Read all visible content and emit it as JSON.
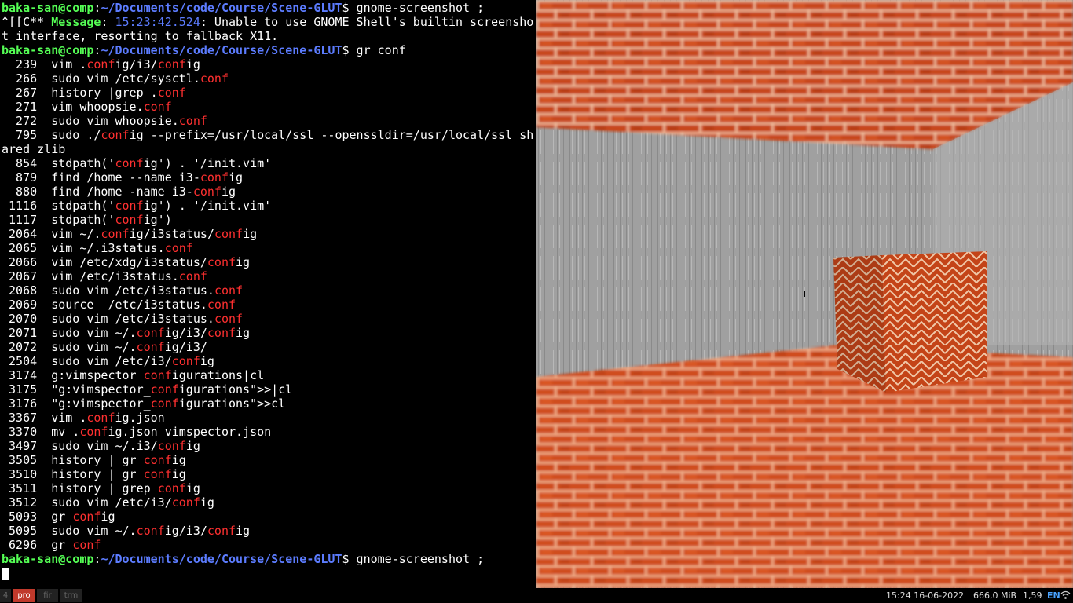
{
  "terminal": {
    "prompt_user": "baka-san@comp",
    "prompt_path": "~/Documents/code/Course/Scene-GLUT",
    "cmd1": "gnome-screenshot ;",
    "msg_prefix": "^[[C** ",
    "msg_label": "Message",
    "msg_colon": ": ",
    "msg_time": "15:23:42.524",
    "msg_text": ": Unable to use GNOME Shell's builtin screensho",
    "msg_wrap": "t interface, resorting to fallback X11.",
    "cmd2": "gr conf",
    "cmd3": "gnome-screenshot ;",
    "history": [
      {
        "num": "  239",
        "cmd": [
          "vim .",
          {
            "h": "conf"
          },
          "ig/i3/",
          {
            "h": "conf"
          },
          "ig"
        ]
      },
      {
        "num": "  266",
        "cmd": [
          "sudo vim /etc/sysctl.",
          {
            "h": "conf"
          }
        ]
      },
      {
        "num": "  267",
        "cmd": [
          "history |grep .",
          {
            "h": "conf"
          }
        ]
      },
      {
        "num": "  271",
        "cmd": [
          "vim whoopsie.",
          {
            "h": "conf"
          }
        ]
      },
      {
        "num": "  272",
        "cmd": [
          "sudo vim whoopsie.",
          {
            "h": "conf"
          }
        ]
      },
      {
        "num": "  795",
        "cmd": [
          "sudo ./",
          {
            "h": "conf"
          },
          "ig --prefix=/usr/local/ssl --openssldir=/usr/local/ssl sh"
        ]
      },
      {
        "num": "",
        "cmd": [
          "ared zlib"
        ]
      },
      {
        "num": "  854",
        "cmd": [
          "stdpath('",
          {
            "h": "conf"
          },
          "ig') . '/init.vim'"
        ]
      },
      {
        "num": "  879",
        "cmd": [
          "find /home --name i3-",
          {
            "h": "conf"
          },
          "ig"
        ]
      },
      {
        "num": "  880",
        "cmd": [
          "find /home -name i3-",
          {
            "h": "conf"
          },
          "ig"
        ]
      },
      {
        "num": " 1116",
        "cmd": [
          "stdpath('",
          {
            "h": "conf"
          },
          "ig') . '/init.vim'"
        ]
      },
      {
        "num": " 1117",
        "cmd": [
          "stdpath('",
          {
            "h": "conf"
          },
          "ig')"
        ]
      },
      {
        "num": " 2064",
        "cmd": [
          "vim ~/.",
          {
            "h": "conf"
          },
          "ig/i3status/",
          {
            "h": "conf"
          },
          "ig"
        ]
      },
      {
        "num": " 2065",
        "cmd": [
          "vim ~/.i3status.",
          {
            "h": "conf"
          }
        ]
      },
      {
        "num": " 2066",
        "cmd": [
          "vim /etc/xdg/i3status/",
          {
            "h": "conf"
          },
          "ig"
        ]
      },
      {
        "num": " 2067",
        "cmd": [
          "vim /etc/i3status.",
          {
            "h": "conf"
          }
        ]
      },
      {
        "num": " 2068",
        "cmd": [
          "sudo vim /etc/i3status.",
          {
            "h": "conf"
          }
        ]
      },
      {
        "num": " 2069",
        "cmd": [
          "source  /etc/i3status.",
          {
            "h": "conf"
          }
        ]
      },
      {
        "num": " 2070",
        "cmd": [
          "sudo vim /etc/i3status.",
          {
            "h": "conf"
          }
        ]
      },
      {
        "num": " 2071",
        "cmd": [
          "sudo vim ~/.",
          {
            "h": "conf"
          },
          "ig/i3/",
          {
            "h": "conf"
          },
          "ig"
        ]
      },
      {
        "num": " 2072",
        "cmd": [
          "sudo vim ~/.",
          {
            "h": "conf"
          },
          "ig/i3/"
        ]
      },
      {
        "num": " 2504",
        "cmd": [
          "sudo vim /etc/i3/",
          {
            "h": "conf"
          },
          "ig"
        ]
      },
      {
        "num": " 3174",
        "cmd": [
          "g:vimspector_",
          {
            "h": "conf"
          },
          "igurations|cl"
        ]
      },
      {
        "num": " 3175",
        "cmd": [
          "\"g:vimspector_",
          {
            "h": "conf"
          },
          "igurations\">>|cl"
        ]
      },
      {
        "num": " 3176",
        "cmd": [
          "\"g:vimspector_",
          {
            "h": "conf"
          },
          "igurations\">>cl"
        ]
      },
      {
        "num": " 3367",
        "cmd": [
          "vim .",
          {
            "h": "conf"
          },
          "ig.json"
        ]
      },
      {
        "num": " 3370",
        "cmd": [
          "mv .",
          {
            "h": "conf"
          },
          "ig.json vimspector.json"
        ]
      },
      {
        "num": " 3497",
        "cmd": [
          "sudo vim ~/.i3/",
          {
            "h": "conf"
          },
          "ig"
        ]
      },
      {
        "num": " 3505",
        "cmd": [
          "history | gr ",
          {
            "h": "conf"
          },
          "ig"
        ]
      },
      {
        "num": " 3510",
        "cmd": [
          "history | gr ",
          {
            "h": "conf"
          },
          "ig"
        ]
      },
      {
        "num": " 3511",
        "cmd": [
          "history | grep ",
          {
            "h": "conf"
          },
          "ig"
        ]
      },
      {
        "num": " 3512",
        "cmd": [
          "sudo vim /etc/i3/",
          {
            "h": "conf"
          },
          "ig"
        ]
      },
      {
        "num": " 5093",
        "cmd": [
          "gr ",
          {
            "h": "conf"
          },
          "ig"
        ]
      },
      {
        "num": " 5095",
        "cmd": [
          "sudo vim ~/.",
          {
            "h": "conf"
          },
          "ig/i3/",
          {
            "h": "conf"
          },
          "ig"
        ]
      },
      {
        "num": " 6296",
        "cmd": [
          "gr ",
          {
            "h": "conf"
          }
        ]
      }
    ]
  },
  "statusbar": {
    "workspaces": [
      {
        "label": "4",
        "active": false
      },
      {
        "label": "pro",
        "active": true
      },
      {
        "label": "fir",
        "active": false
      },
      {
        "label": "trm",
        "active": false
      }
    ],
    "datetime": "15:24 16-06-2022",
    "memory": "666,0 MiB",
    "load": "1,59",
    "lang": "EN",
    "wifi_icon": "wifi-icon"
  },
  "colors": {
    "prompt_user": "#55ff55",
    "prompt_path": "#5c7cff",
    "highlight": "#ff3030",
    "active_workspace": "#c0392b",
    "brick": "#c8461c",
    "mortar": "#f4c7a8",
    "wall": "#9c9c9c"
  }
}
